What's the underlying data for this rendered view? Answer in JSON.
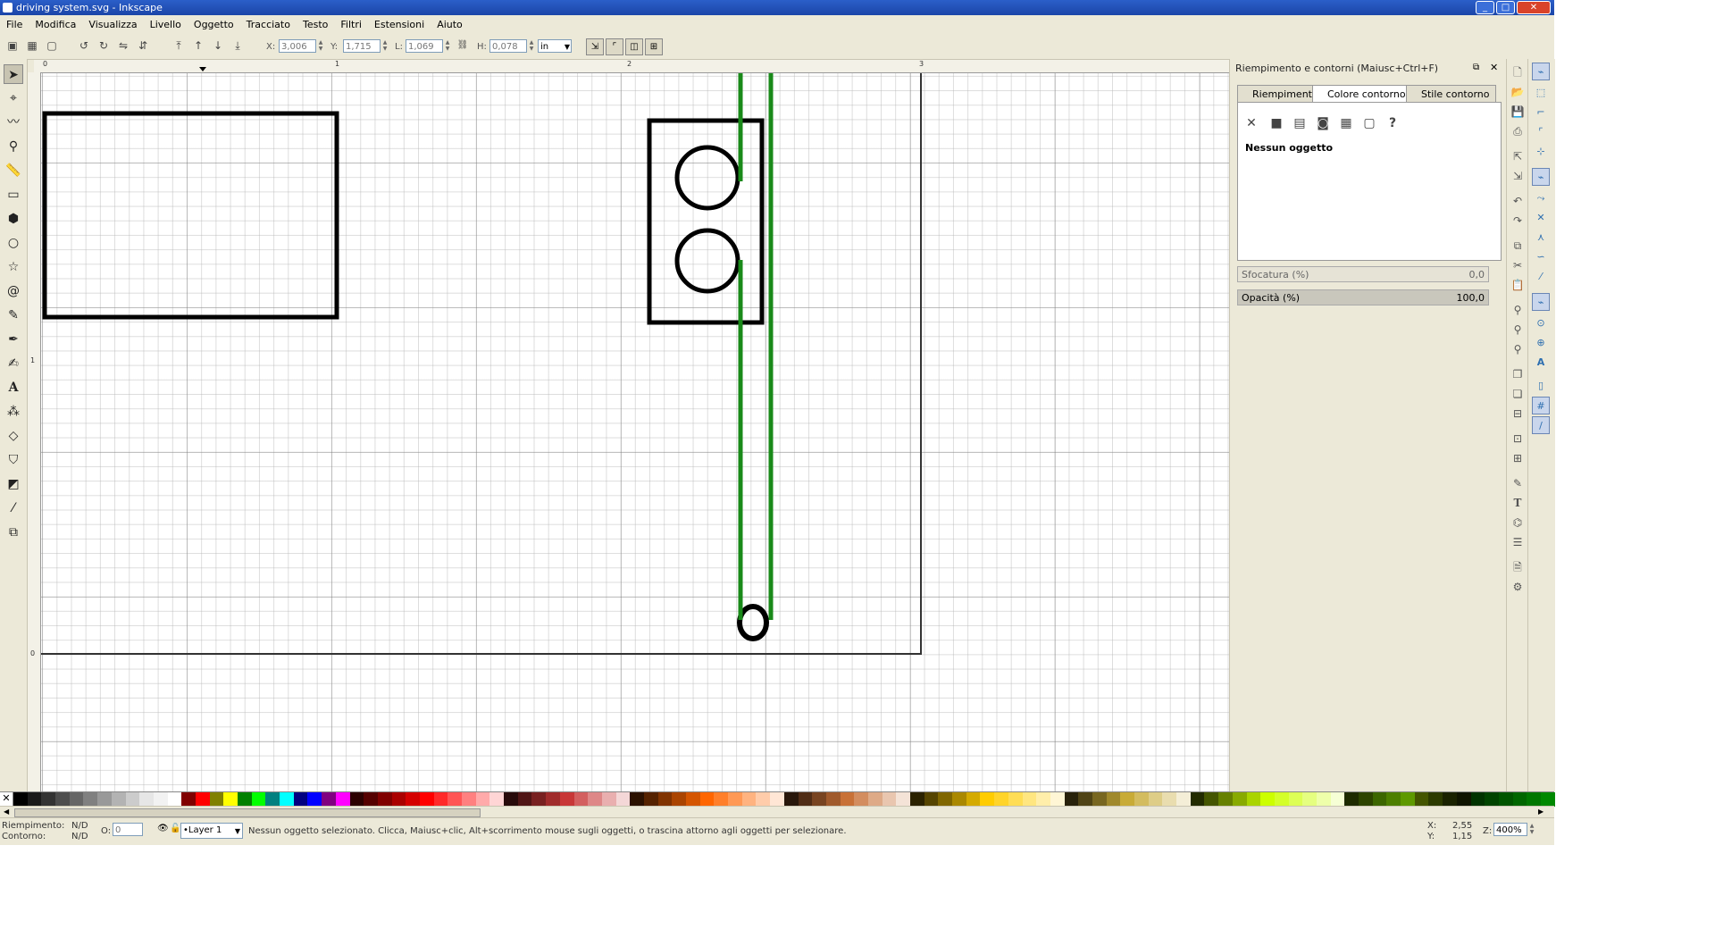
{
  "window": {
    "title": "driving system.svg - Inkscape",
    "minimize": "_",
    "maximize": "□",
    "close": "✕"
  },
  "menu": [
    "File",
    "Modifica",
    "Visualizza",
    "Livello",
    "Oggetto",
    "Tracciato",
    "Testo",
    "Filtri",
    "Estensioni",
    "Aiuto"
  ],
  "toolbar": {
    "x_label": "X:",
    "x_value": "3,006",
    "y_label": "Y:",
    "y_value": "1,715",
    "w_label": "L:",
    "w_value": "1,069",
    "h_label": "H:",
    "h_value": "0,078",
    "unit": "in"
  },
  "ruler": {
    "h_labels": [
      "0",
      "1",
      "2",
      "3"
    ],
    "v_labels": [
      "1",
      "0"
    ]
  },
  "dialog": {
    "title": "Riempimento e contorni (Maiusc+Ctrl+F)",
    "tabs": [
      "Riempimento",
      "Colore contorno",
      "Stile contorno"
    ],
    "question": "?",
    "no_object": "Nessun oggetto",
    "blur_label": "Sfocatura (%)",
    "blur_value": "0,0",
    "opacity_label": "Opacità (%)",
    "opacity_value": "100,0"
  },
  "status": {
    "fill_label": "Riempimento:",
    "fill_value": "N/D",
    "stroke_label": "Contorno:",
    "stroke_value": "N/D",
    "o_label": "O:",
    "o_value": "0",
    "layer": "•Layer 1",
    "message": "Nessun oggetto selezionato. Clicca, Maiusc+clic, Alt+scorrimento mouse sugli oggetti, o trascina attorno agli oggetti per selezionare.",
    "x_label": "X:",
    "x_value": "2,55",
    "y_label": "Y:",
    "y_value": "1,15",
    "zoom_label": "Z:",
    "zoom_value": "400%"
  },
  "colors": {
    "stroke_black": "#000000",
    "stroke_green": "#1a8a1a",
    "page_border": "#333333"
  },
  "palette": [
    "#000000",
    "#1a1a1a",
    "#333333",
    "#4d4d4d",
    "#666666",
    "#808080",
    "#999999",
    "#b3b3b3",
    "#cccccc",
    "#e6e6e6",
    "#f2f2f2",
    "#ffffff",
    "#800000",
    "#ff0000",
    "#808000",
    "#ffff00",
    "#008000",
    "#00ff00",
    "#008080",
    "#00ffff",
    "#000080",
    "#0000ff",
    "#800080",
    "#ff00ff",
    "#2b0000",
    "#550000",
    "#800000",
    "#aa0000",
    "#d40000",
    "#ff0000",
    "#ff2a2a",
    "#ff5555",
    "#ff8080",
    "#ffaaaa",
    "#ffd5d5",
    "#280b0b",
    "#501616",
    "#782121",
    "#a02c2c",
    "#c83737",
    "#d35f5f",
    "#de8787",
    "#e9afaf",
    "#f4d7d7",
    "#2b1100",
    "#552200",
    "#803300",
    "#aa4400",
    "#d45500",
    "#ff6600",
    "#ff7f2a",
    "#ff9955",
    "#ffb380",
    "#ffccaa",
    "#ffe6d5",
    "#28170b",
    "#502d16",
    "#784421",
    "#a05a2c",
    "#c87137",
    "#d38d5f",
    "#deaa87",
    "#e9c6af",
    "#f4e3d7",
    "#2b2200",
    "#554400",
    "#806600",
    "#aa8800",
    "#d4aa00",
    "#ffcc00",
    "#ffd42a",
    "#ffdd55",
    "#ffe680",
    "#ffeeaa",
    "#fff6d5",
    "#28220b",
    "#504416",
    "#786721",
    "#a0892c",
    "#c8ab37",
    "#d3bc5f",
    "#decd87",
    "#e9ddaf",
    "#f4eed7",
    "#222b00",
    "#445500",
    "#668000",
    "#88aa00",
    "#aad400",
    "#ccff00",
    "#d4ff2a",
    "#ddff55",
    "#e5ff80",
    "#eeffaa",
    "#f6ffd5",
    "#1e2b00",
    "#2d4400",
    "#3c6600",
    "#4d7f00",
    "#5e9900",
    "#445500",
    "#2c3a00",
    "#1a2200",
    "#0f1400",
    "#003300",
    "#004400",
    "#005500",
    "#006600",
    "#007700",
    "#008800"
  ],
  "tool_icons": [
    "selector-icon",
    "node-icon",
    "tweak-icon",
    "zoom-icon",
    "measure-icon",
    "rect-icon",
    "3dbox-icon",
    "ellipse-icon",
    "star-icon",
    "spiral-icon",
    "pencil-icon",
    "pen-icon",
    "calligraphy-icon",
    "text-icon",
    "spray-icon",
    "eraser-icon",
    "bucket-icon",
    "gradient-icon",
    "dropper-icon",
    "connector-icon"
  ],
  "cmd_icons": [
    "new-icon",
    "open-icon",
    "save-icon",
    "print-icon",
    "import-icon",
    "export-icon",
    "undo-icon",
    "redo-icon",
    "copy-icon",
    "cut-icon",
    "paste-icon",
    "zoom-selection-icon",
    "zoom-drawing-icon",
    "zoom-page-icon",
    "duplicate-icon",
    "clone-icon",
    "unlink-icon",
    "group-icon",
    "ungroup-icon",
    "xml-editor-icon",
    "text-font-icon",
    "fill-stroke-icon",
    "preferences-icon",
    "document-properties-icon",
    "align-icon"
  ],
  "snap_icons": [
    "snap-toggle-icon",
    "snap-bbox-icon",
    "snap-bbox-edge-icon",
    "snap-bbox-corner-icon",
    "snap-bbox-midpoint-icon",
    "snap-nodes-icon",
    "snap-path-icon",
    "snap-intersection-icon",
    "snap-cusp-icon",
    "snap-smooth-icon",
    "snap-midpoint-icon",
    "snap-others-icon",
    "snap-center-icon",
    "snap-rotation-icon",
    "snap-text-baseline-icon",
    "snap-page-icon",
    "snap-grid-icon",
    "snap-guide-icon"
  ]
}
